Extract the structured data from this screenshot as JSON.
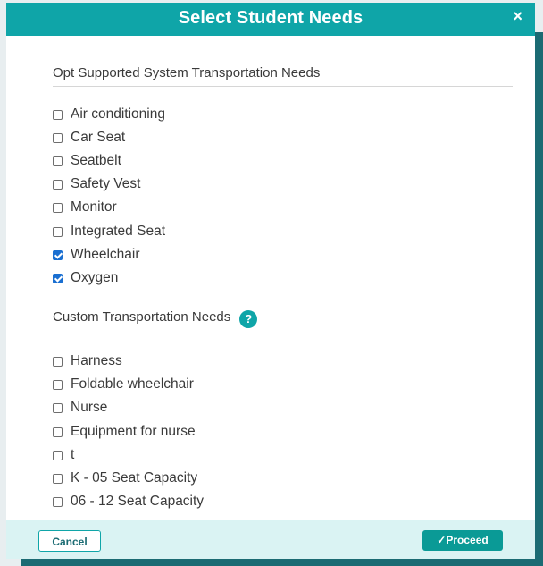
{
  "dialog": {
    "title": "Select Student Needs",
    "close_icon": "×"
  },
  "sections": [
    {
      "heading": "Opt Supported System Transportation Needs",
      "options": [
        {
          "label": "Air conditioning",
          "checked": false
        },
        {
          "label": "Car Seat",
          "checked": false
        },
        {
          "label": "Seatbelt",
          "checked": false
        },
        {
          "label": "Safety Vest",
          "checked": false
        },
        {
          "label": "Monitor",
          "checked": false
        },
        {
          "label": "Integrated Seat",
          "checked": false
        },
        {
          "label": "Wheelchair",
          "checked": true
        },
        {
          "label": "Oxygen",
          "checked": true
        }
      ]
    },
    {
      "heading": "Custom Transportation Needs",
      "help_icon": "?",
      "options": [
        {
          "label": "Harness",
          "checked": false
        },
        {
          "label": "Foldable wheelchair",
          "checked": false
        },
        {
          "label": "Nurse",
          "checked": false
        },
        {
          "label": "Equipment for nurse",
          "checked": false
        },
        {
          "label": "t",
          "checked": false
        },
        {
          "label": "K - 05 Seat Capacity",
          "checked": false
        },
        {
          "label": "06 - 12 Seat Capacity",
          "checked": false
        }
      ]
    }
  ],
  "footer": {
    "cancel_label": "Cancel",
    "proceed_label": "✓Proceed"
  },
  "colors": {
    "accent": "#0fa5a8",
    "checkbox_checked": "#1a6fd1",
    "footer_bg": "#daf3f3"
  }
}
